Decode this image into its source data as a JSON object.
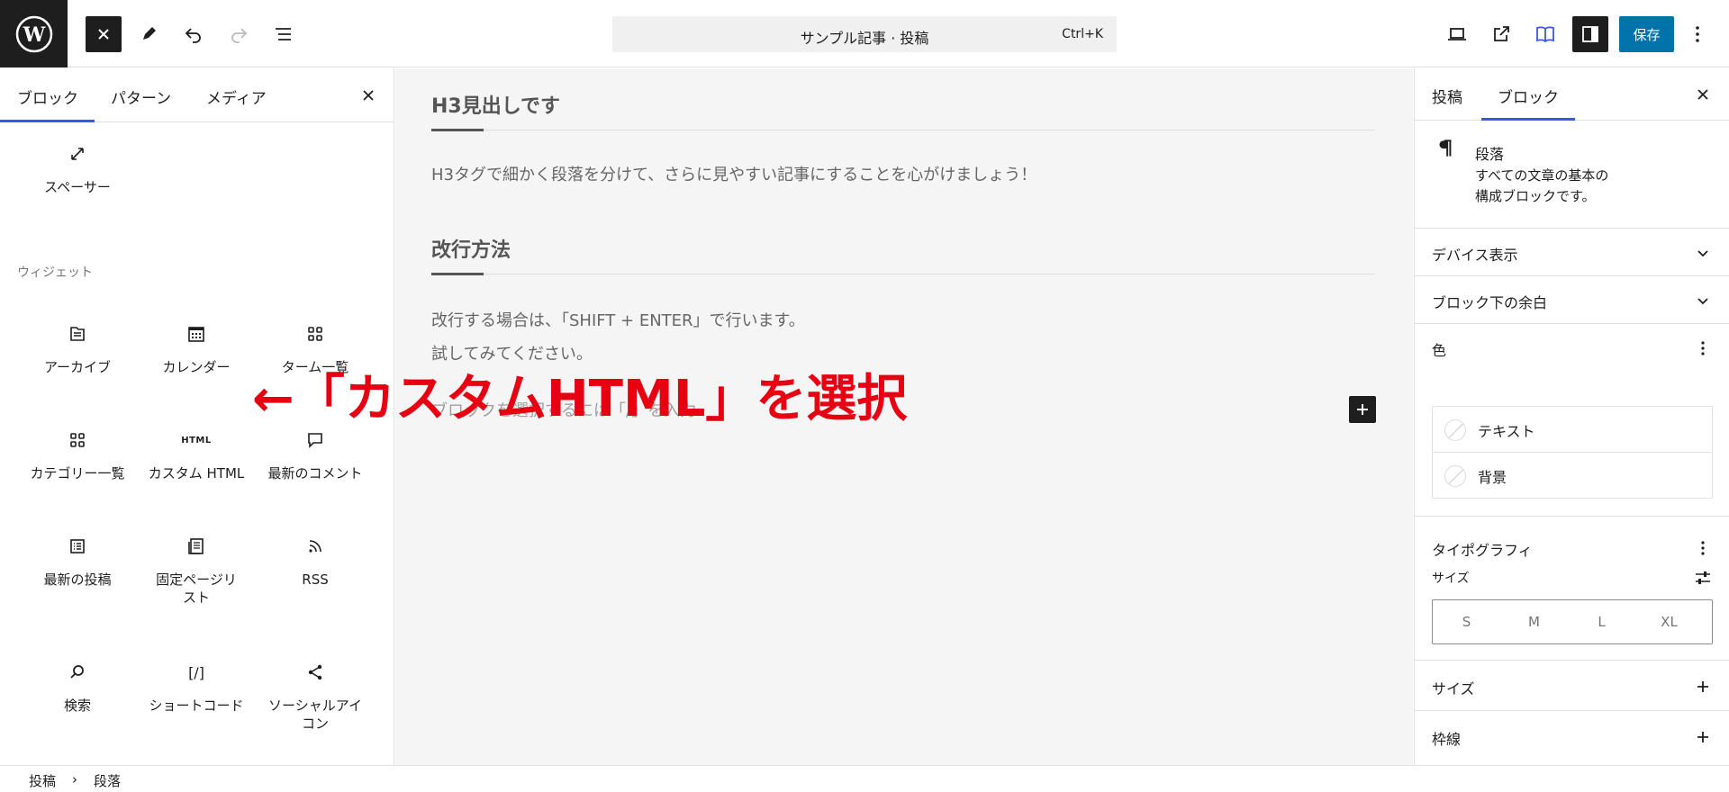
{
  "header": {
    "document_title": "サンプル記事 · 投稿",
    "shortcut": "Ctrl+K",
    "save_label": "保存"
  },
  "inserter": {
    "tabs": [
      "ブロック",
      "パターン",
      "メディア"
    ],
    "spacer_label": "スペーサー",
    "widgets_heading": "ウィジェット",
    "widgets": [
      {
        "label": "アーカイブ",
        "icon": "archive-icon"
      },
      {
        "label": "カレンダー",
        "icon": "calendar-icon"
      },
      {
        "label": "ターム一覧",
        "icon": "grid-icon"
      },
      {
        "label": "カテゴリー一覧",
        "icon": "grid-icon"
      },
      {
        "label": "カスタム HTML",
        "icon": "html-icon",
        "icon_text": "HTML"
      },
      {
        "label": "最新のコメント",
        "icon": "comment-icon"
      },
      {
        "label": "最新の投稿",
        "icon": "list-icon"
      },
      {
        "label": "固定ページリスト",
        "icon": "pages-icon"
      },
      {
        "label": "RSS",
        "icon": "rss-icon"
      },
      {
        "label": "検索",
        "icon": "search-icon"
      },
      {
        "label": "ショートコード",
        "icon": "shortcode-icon",
        "icon_text": "[/]"
      },
      {
        "label": "ソーシャルアイコン",
        "icon": "share-icon"
      }
    ]
  },
  "canvas": {
    "heading1": "H3見出しです",
    "para1": "H3タグで細かく段落を分けて、さらに見やすい記事にすることを心がけましょう！",
    "heading2": "改行方法",
    "para2_line1": "改行する場合は、「SHIFT + ENTER」で行います。",
    "para2_line2": "試してみてください。",
    "placeholder": "ブロックを選択するには「/」を入力",
    "annotation": "←「カスタムHTML」を選択"
  },
  "sidebar": {
    "tabs": [
      "投稿",
      "ブロック"
    ],
    "block_title": "段落",
    "block_desc_line1": "すべての文章の基本の",
    "block_desc_line2": "構成ブロックです。",
    "panels": {
      "device": "デバイス表示",
      "margin": "ブロック下の余白",
      "color": "色",
      "typography": "タイポグラフィ",
      "size_label": "サイズ",
      "size_panel": "サイズ",
      "border": "枠線"
    },
    "color_items": [
      "テキスト",
      "背景"
    ],
    "font_sizes": [
      "S",
      "M",
      "L",
      "XL"
    ]
  },
  "breadcrumb": {
    "items": [
      "投稿",
      "段落"
    ],
    "separator": "›"
  },
  "colors": {
    "accent": "#3858e9",
    "save": "#0073aa",
    "annotation": "#e60012"
  }
}
